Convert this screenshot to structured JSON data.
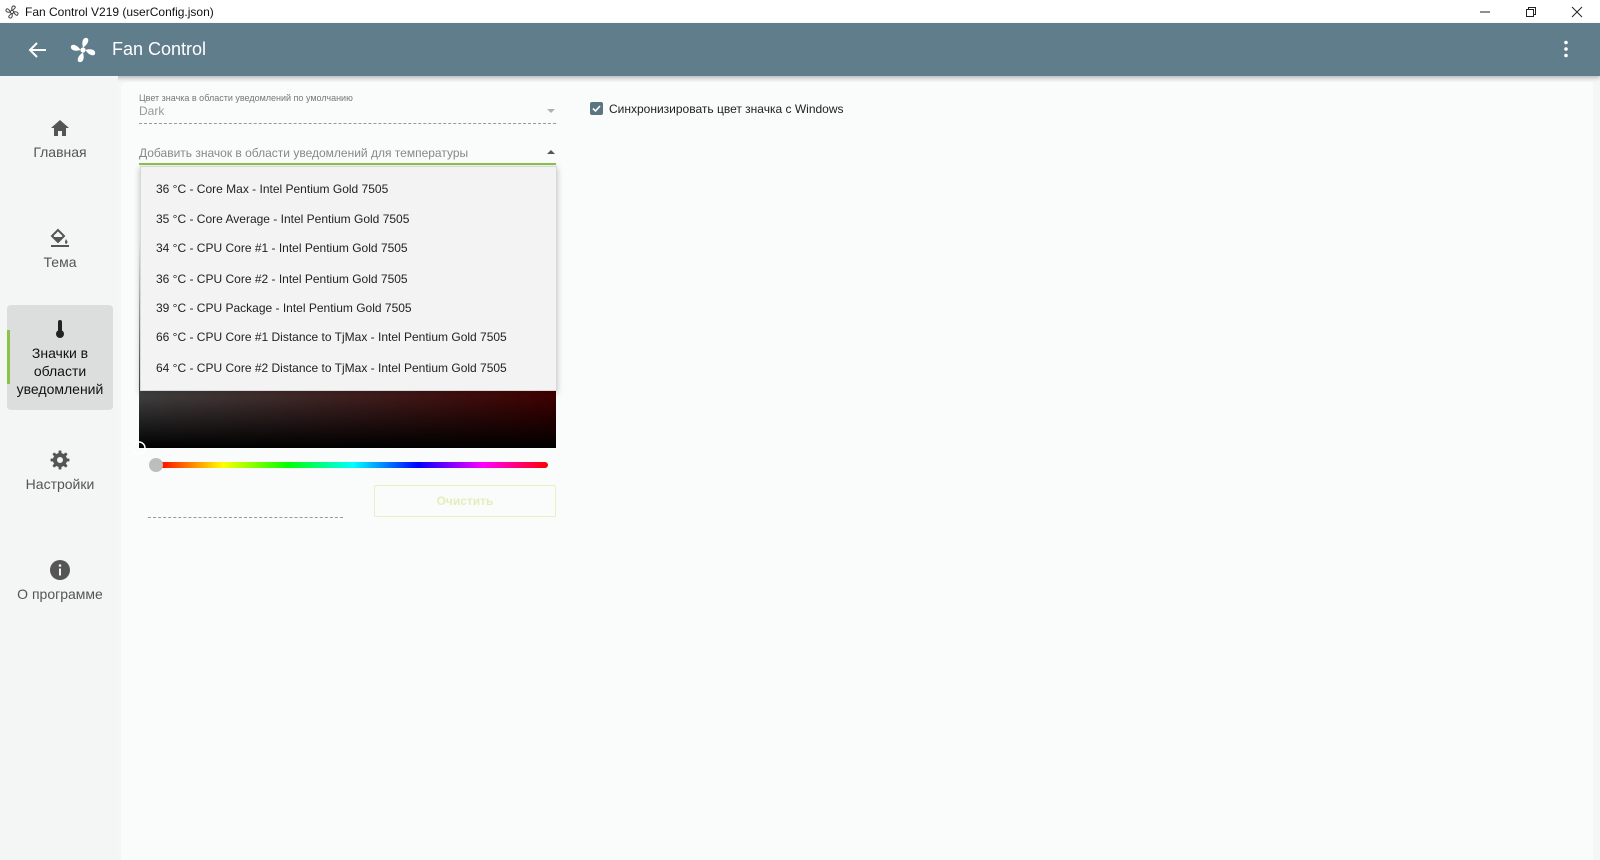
{
  "window": {
    "title": "Fan Control V219 (userConfig.json)"
  },
  "appbar": {
    "name": "Fan Control"
  },
  "sidebar": {
    "items": [
      {
        "label": "Главная",
        "icon": "home-icon"
      },
      {
        "label": "Тема",
        "icon": "paint-bucket-icon"
      },
      {
        "label": "Значки в области уведомлений",
        "icon": "thermometer-icon",
        "active": true
      },
      {
        "label": "Настройки",
        "icon": "gear-icon"
      },
      {
        "label": "О программе",
        "icon": "info-icon"
      }
    ]
  },
  "main": {
    "default_icon_color": {
      "label": "Цвет значка в области уведомлений по умолчанию",
      "value": "Dark"
    },
    "add_temp_icon": {
      "label": "Добавить значок в области уведомлений для температуры"
    },
    "sync_checkbox": {
      "label": "Синхронизировать цвет значка с Windows",
      "checked": true
    },
    "clear_button": "Очистить",
    "dropdown_options": [
      "36 °C - Core Max - Intel Pentium Gold 7505",
      "35 °C - Core Average - Intel Pentium Gold 7505",
      "34 °C - CPU Core #1 - Intel Pentium Gold 7505",
      "36 °C - CPU Core #2 - Intel Pentium Gold 7505",
      "39 °C - CPU Package - Intel Pentium Gold 7505",
      "66 °C - CPU Core #1 Distance to TjMax - Intel Pentium Gold 7505",
      "64 °C - CPU Core #2 Distance to TjMax - Intel Pentium Gold 7505"
    ]
  },
  "colors": {
    "appbar": "#607d8b",
    "accent": "#8bc34a",
    "checkbox": "#5b7582"
  }
}
